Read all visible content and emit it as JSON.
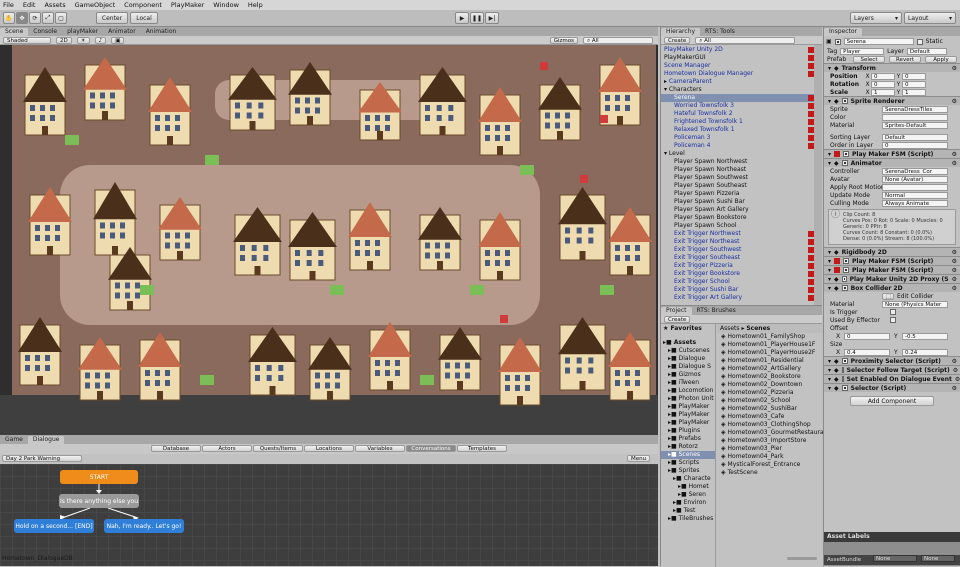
{
  "menu": [
    "File",
    "Edit",
    "Assets",
    "GameObject",
    "Component",
    "PlayMaker",
    "Window",
    "Help"
  ],
  "toolbar": {
    "center": "Center",
    "local": "Local",
    "layers": "Layers",
    "layout": "Layout"
  },
  "scene": {
    "tabs": [
      "Scene",
      "Console",
      "playMaker",
      "Animator",
      "Animation"
    ],
    "shaded": "Shaded",
    "mode2d": "2D",
    "gizmos": "Gizmos",
    "search": "All"
  },
  "hierarchy": {
    "tabs": [
      "Hierarchy",
      "RTS: Tools"
    ],
    "create": "Create",
    "search": "All",
    "items": [
      {
        "label": "PlayMaker Unity 2D",
        "indent": 0,
        "color": "blue",
        "pm": true
      },
      {
        "label": "PlayMakerGUI",
        "indent": 0,
        "color": "black",
        "pm": true
      },
      {
        "label": "Scene Manager",
        "indent": 0,
        "color": "blue",
        "pm": true
      },
      {
        "label": "Hometown Dialogue Manager",
        "indent": 0,
        "color": "blue",
        "pm": true
      },
      {
        "label": "CameraParent",
        "indent": 0,
        "color": "blue",
        "arrow": "▸"
      },
      {
        "label": "Characters",
        "indent": 0,
        "color": "black",
        "arrow": "▾"
      },
      {
        "label": "Serena",
        "indent": 1,
        "color": "sel",
        "pm": true
      },
      {
        "label": "Worried Townsfolk 3",
        "indent": 1,
        "color": "blue",
        "pm": true
      },
      {
        "label": "Hateful Townsfolk 2",
        "indent": 1,
        "color": "blue",
        "pm": true
      },
      {
        "label": "Frightened Townsfolk 1",
        "indent": 1,
        "color": "blue",
        "pm": true
      },
      {
        "label": "Relaxed Townsfolk 1",
        "indent": 1,
        "color": "blue",
        "pm": true
      },
      {
        "label": "Policeman 3",
        "indent": 1,
        "color": "blue",
        "pm": true
      },
      {
        "label": "Policeman 4",
        "indent": 1,
        "color": "blue",
        "pm": true
      },
      {
        "label": "Level",
        "indent": 0,
        "color": "black",
        "arrow": "▾"
      },
      {
        "label": "Player Spawn Northwest",
        "indent": 1,
        "color": "black"
      },
      {
        "label": "Player Spawn Northeast",
        "indent": 1,
        "color": "black"
      },
      {
        "label": "Player Spawn Southwest",
        "indent": 1,
        "color": "black"
      },
      {
        "label": "Player Spawn Southeast",
        "indent": 1,
        "color": "black"
      },
      {
        "label": "Player Spawn Pizzeria",
        "indent": 1,
        "color": "black"
      },
      {
        "label": "Player Spawn Sushi Bar",
        "indent": 1,
        "color": "black"
      },
      {
        "label": "Player Spawn Art Gallery",
        "indent": 1,
        "color": "black"
      },
      {
        "label": "Player Spawn Bookstore",
        "indent": 1,
        "color": "black"
      },
      {
        "label": "Player Spawn School",
        "indent": 1,
        "color": "black"
      },
      {
        "label": "Exit Trigger Northwest",
        "indent": 1,
        "color": "blue",
        "pm": true
      },
      {
        "label": "Exit Trigger Northeast",
        "indent": 1,
        "color": "blue",
        "pm": true
      },
      {
        "label": "Exit Trigger Southwest",
        "indent": 1,
        "color": "blue",
        "pm": true
      },
      {
        "label": "Exit Trigger Southeast",
        "indent": 1,
        "color": "blue",
        "pm": true
      },
      {
        "label": "Exit Trigger Pizzeria",
        "indent": 1,
        "color": "blue",
        "pm": true
      },
      {
        "label": "Exit Trigger Bookstore",
        "indent": 1,
        "color": "blue",
        "pm": true
      },
      {
        "label": "Exit Trigger School",
        "indent": 1,
        "color": "blue",
        "pm": true
      },
      {
        "label": "Exit Trigger Sushi Bar",
        "indent": 1,
        "color": "blue",
        "pm": true
      },
      {
        "label": "Exit Trigger Art Gallery",
        "indent": 1,
        "color": "blue",
        "pm": true
      }
    ]
  },
  "project": {
    "tabs": [
      "Project",
      "RTS: Brushes"
    ],
    "create": "Create",
    "favorites": "Favorites",
    "breadcrumb": [
      "Assets",
      "Scenes"
    ],
    "tree": [
      {
        "label": "Assets",
        "indent": 0,
        "bold": true
      },
      {
        "label": "Cutscenes",
        "indent": 1
      },
      {
        "label": "Dialogue",
        "indent": 1
      },
      {
        "label": "Dialogue S",
        "indent": 1
      },
      {
        "label": "Gizmos",
        "indent": 1
      },
      {
        "label": "iTween",
        "indent": 1
      },
      {
        "label": "Locomotion",
        "indent": 1
      },
      {
        "label": "Photon Unit",
        "indent": 1
      },
      {
        "label": "PlayMaker",
        "indent": 1
      },
      {
        "label": "PlayMaker",
        "indent": 1
      },
      {
        "label": "PlayMaker",
        "indent": 1
      },
      {
        "label": "Plugins",
        "indent": 1
      },
      {
        "label": "Prefabs",
        "indent": 1
      },
      {
        "label": "Rotorz",
        "indent": 1
      },
      {
        "label": "Scenes",
        "indent": 1,
        "sel": true
      },
      {
        "label": "Scripts",
        "indent": 1
      },
      {
        "label": "Sprites",
        "indent": 1
      },
      {
        "label": "Characte",
        "indent": 2
      },
      {
        "label": "Homet",
        "indent": 3
      },
      {
        "label": "Seren",
        "indent": 3
      },
      {
        "label": "Environ",
        "indent": 2
      },
      {
        "label": "Test",
        "indent": 2
      },
      {
        "label": "TileBrushes",
        "indent": 1
      }
    ],
    "files": [
      "Hometown01_FamilyShop",
      "Hometown01_PlayerHouse1F",
      "Hometown01_PlayerHouse2F",
      "Hometown01_Residential",
      "Hometown02_ArtGallery",
      "Hometown02_Bookstore",
      "Hometown02_Downtown",
      "Hometown02_Pizzeria",
      "Hometown02_School",
      "Hometown02_SushiBar",
      "Hometown03_Cafe",
      "Hometown03_ClothingShop",
      "Hometown03_GourmetRestaurant",
      "Hometown03_ImportStore",
      "Hometown03_Pier",
      "Hometown04_Park",
      "MysticalForest_Entrance",
      "TestScene"
    ]
  },
  "inspector": {
    "tab": "Inspector",
    "name": "Serena",
    "static": "Static",
    "tag_label": "Tag",
    "tag": "Player",
    "layer_label": "Layer",
    "layer": "Default",
    "prefab_label": "Prefab",
    "prefab_buttons": [
      "Select",
      "Revert",
      "Apply"
    ],
    "transform": {
      "title": "Transform",
      "rows": [
        {
          "label": "Position",
          "x": "0",
          "y": "0",
          "z": "0"
        },
        {
          "label": "Rotation",
          "x": "0",
          "y": "0",
          "z": "0"
        },
        {
          "label": "Scale",
          "x": "1",
          "y": "1",
          "z": "1"
        }
      ]
    },
    "sprite_renderer": {
      "title": "Sprite Renderer",
      "rows": [
        {
          "label": "Sprite",
          "value": "SerenaDressTiles"
        },
        {
          "label": "Color",
          "value": ""
        },
        {
          "label": "Material",
          "value": "Sprites-Default"
        },
        {
          "label": "Sorting Layer",
          "value": "Default"
        },
        {
          "label": "Order in Layer",
          "value": "0"
        }
      ]
    },
    "pm_fsm_1": "Play Maker FSM (Script)",
    "animator": {
      "title": "Animator",
      "rows": [
        {
          "label": "Controller",
          "value": "SerenaDress_Cor"
        },
        {
          "label": "Avatar",
          "value": "None (Avatar)"
        },
        {
          "label": "Apply Root Motion",
          "value": ""
        },
        {
          "label": "Update Mode",
          "value": "Normal"
        },
        {
          "label": "Culling Mode",
          "value": "Always Animate"
        }
      ],
      "info": [
        "Clip Count: 8",
        "Curves Pos: 0 Rot: 0 Scale: 0 Muscles: 0",
        "Generic: 0 PPtr: 8",
        "Curves Count: 8 Constant: 0 (0.0%)",
        "Dense: 0 (0.0%) Stream: 8 (100.0%)"
      ]
    },
    "rigidbody": "Rigidbody 2D",
    "pm_fsm_2": "Play Maker FSM (Script)",
    "pm_fsm_3": "Play Maker FSM (Script)",
    "pm_proxy": "Play Maker Unity 2D Proxy (S",
    "box_collider": {
      "title": "Box Collider 2D",
      "edit": "Edit Collider",
      "material_label": "Material",
      "material": "None (Physics Mater",
      "is_trigger": "Is Trigger",
      "used_by_effector": "Used By Effector",
      "offset_label": "Offset",
      "offset": {
        "x": "0",
        "y": "-0.5"
      },
      "size_label": "Size",
      "size": {
        "x": "0.4",
        "y": "0.24"
      }
    },
    "scripts": [
      "Proximity Selector (Script)",
      "Selector Follow Target (Script)",
      "Set Enabled On Dialogue Event",
      "Selector (Script)"
    ],
    "add_component": "Add Component",
    "asset_labels": "Asset Labels",
    "asset_bundle": "AssetBundle",
    "bundle_none_1": "None",
    "bundle_none_2": "None"
  },
  "dialogue": {
    "tabs": [
      "Game",
      "Dialogue"
    ],
    "toptabs": [
      "Database",
      "Actors",
      "Quests/Items",
      "Locations",
      "Variables",
      "Conversations",
      "Templates"
    ],
    "active_toptab": "Conversations",
    "conversation": "Day 2 Park Warning",
    "menu": "Menu",
    "nodes": {
      "start": "START",
      "question": "Is there anything else you",
      "reply_left": "Hold on a second... [END]",
      "reply_right": "Nah, I'm ready.. Let's go!"
    },
    "footer": "Hometown_DialogueDB"
  },
  "colors": {
    "start_node": "#f08c1a",
    "npc_node": "#9a9a9a",
    "pc_node": "#2f7fd8",
    "dialogue_bg": "#3e3e3e",
    "road": "#8a6a5c",
    "plaza": "#b79a8c",
    "roof_dark": "#4a2f1a",
    "roof_red": "#c46a4a",
    "wall": "#eedcb0",
    "grass": "#7bbd57"
  }
}
